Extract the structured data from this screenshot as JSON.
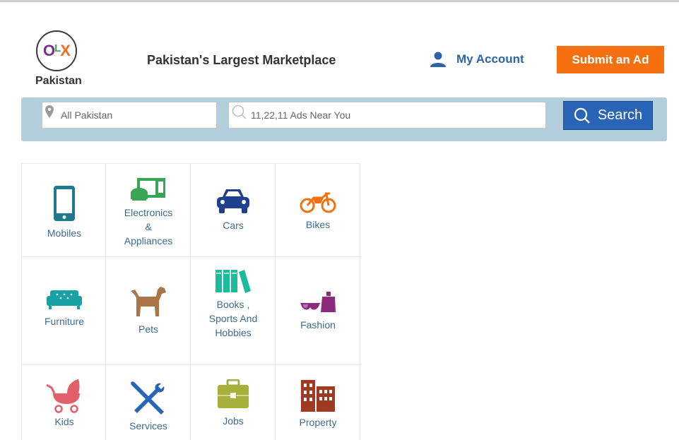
{
  "header": {
    "logo_text": "OLX",
    "country": "Pakistan",
    "tagline": "Pakistan's Largest Marketplace",
    "account_label": "My Account",
    "submit_label": "Submit an Ad"
  },
  "search": {
    "location_value": "All Pakistan",
    "query_placeholder": "11,22,11 Ads Near You",
    "button_label": "Search"
  },
  "categories": [
    {
      "label": "Mobiles",
      "icon": "mobile-phone-icon",
      "color": "#1e7a8c"
    },
    {
      "label": "Electronics & Appliances",
      "icon": "microwave-icon",
      "color": "#3aa655"
    },
    {
      "label": "Cars",
      "icon": "car-icon",
      "color": "#1f3f8f"
    },
    {
      "label": "Bikes",
      "icon": "motorbike-icon",
      "color": "#f6700f"
    },
    {
      "label": "Furniture",
      "icon": "sofa-icon",
      "color": "#17a3a3"
    },
    {
      "label": "Pets",
      "icon": "dog-icon",
      "color": "#a9764a"
    },
    {
      "label": "Books , Sports And Hobbies",
      "icon": "books-icon",
      "color": "#1abc9c"
    },
    {
      "label": "Fashion",
      "icon": "sunglasses-perfume-icon",
      "color": "#8b2a7e"
    },
    {
      "label": "Kids",
      "icon": "pram-icon",
      "color": "#e2606a"
    },
    {
      "label": "Services",
      "icon": "tools-icon",
      "color": "#2a64b6"
    },
    {
      "label": "Jobs",
      "icon": "briefcase-icon",
      "color": "#a6b03a"
    },
    {
      "label": "Property",
      "icon": "buildings-icon",
      "color": "#a23a23"
    }
  ]
}
